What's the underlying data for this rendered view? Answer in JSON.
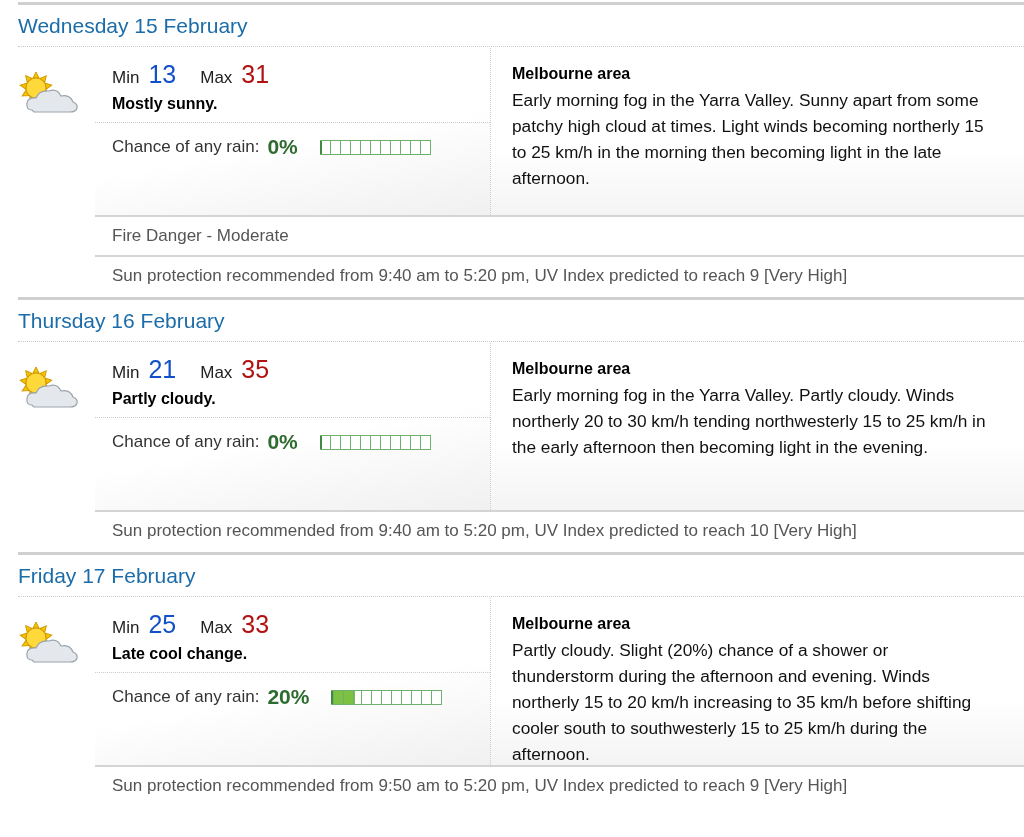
{
  "days": [
    {
      "title": "Wednesday 15 February",
      "min_label": "Min",
      "min": "13",
      "max_label": "Max",
      "max": "31",
      "summary": "Mostly sunny.",
      "rain_label": "Chance of any rain:",
      "rain": "0%",
      "level": 0,
      "area": "Melbourne area",
      "forecast": "Early morning fog in the Yarra Valley. Sunny apart from some patchy high cloud at times. Light winds becoming northerly 15 to 25 km/h in the morning then becoming light in the late afternoon.",
      "notes": [
        "Fire Danger - Moderate",
        "Sun protection recommended from 9:40 am to 5:20 pm, UV Index predicted to reach 9 [Very High]"
      ]
    },
    {
      "title": "Thursday 16 February",
      "min_label": "Min",
      "min": "21",
      "max_label": "Max",
      "max": "35",
      "summary": "Partly cloudy.",
      "rain_label": "Chance of any rain:",
      "rain": "0%",
      "level": 0,
      "area": "Melbourne area",
      "forecast": "Early morning fog in the Yarra Valley. Partly cloudy. Winds northerly 20 to 30 km/h tending northwesterly 15 to 25 km/h in the early afternoon then becoming light in the evening.",
      "notes": [
        "Sun protection recommended from 9:40 am to 5:20 pm, UV Index predicted to reach 10 [Very High]"
      ]
    },
    {
      "title": "Friday 17 February",
      "min_label": "Min",
      "min": "25",
      "max_label": "Max",
      "max": "33",
      "summary": "Late cool change.",
      "rain_label": "Chance of any rain:",
      "rain": "20%",
      "level": 0.2,
      "area": "Melbourne area",
      "forecast": "Partly cloudy. Slight (20%) chance of a shower or thunderstorm during the afternoon and evening. Winds northerly 15 to 20 km/h increasing to 35 km/h before shifting cooler south to southwesterly 15 to 25 km/h during the afternoon.",
      "notes": [
        "Sun protection recommended from 9:50 am to 5:20 pm, UV Index predicted to reach 9 [Very High]"
      ]
    }
  ]
}
